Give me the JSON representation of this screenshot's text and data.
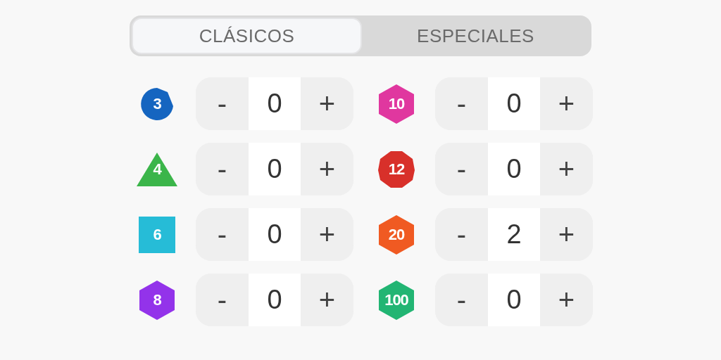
{
  "tabs": [
    {
      "label": "CLÁSICOS",
      "selected": true
    },
    {
      "label": "ESPECIALES",
      "selected": false
    }
  ],
  "dice": [
    {
      "label": "3",
      "kind": "circle",
      "color": "#1565c0",
      "minus": "-",
      "value": "0",
      "plus": "+"
    },
    {
      "label": "10",
      "kind": "hexagon",
      "color": "#e0379f",
      "minus": "-",
      "value": "0",
      "plus": "+"
    },
    {
      "label": "4",
      "kind": "triangle",
      "color": "#3bb54a",
      "minus": "-",
      "value": "0",
      "plus": "+"
    },
    {
      "label": "12",
      "kind": "octagon",
      "color": "#d8302a",
      "minus": "-",
      "value": "0",
      "plus": "+"
    },
    {
      "label": "6",
      "kind": "square",
      "color": "#26bcd7",
      "minus": "-",
      "value": "0",
      "plus": "+"
    },
    {
      "label": "20",
      "kind": "hexagon",
      "color": "#f05a22",
      "minus": "-",
      "value": "2",
      "plus": "+"
    },
    {
      "label": "8",
      "kind": "hexagon",
      "color": "#9333ea",
      "minus": "-",
      "value": "0",
      "plus": "+"
    },
    {
      "label": "100",
      "kind": "hexagon",
      "color": "#22b573",
      "minus": "-",
      "value": "0",
      "plus": "+"
    }
  ]
}
